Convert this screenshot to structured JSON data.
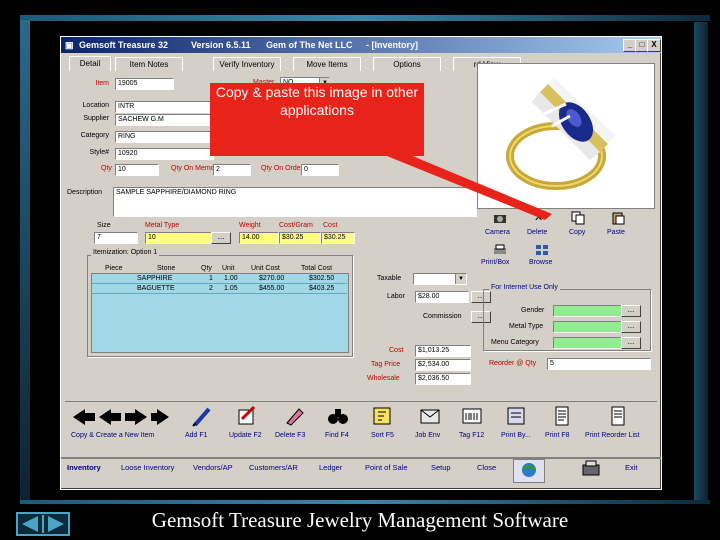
{
  "window": {
    "title_app": "Gemsoft Treasure 32",
    "title_version": "Version 6.5.11",
    "title_company": "Gem of The Net LLC",
    "title_view": "- [Inventory]",
    "btn_min": "_",
    "btn_max": "□",
    "btn_close": "X"
  },
  "tabs": [
    "Detail",
    "Item Notes",
    "Verify Inventory",
    "Move Items",
    "Options",
    "rd View"
  ],
  "form": {
    "item_label": "Item",
    "item_value": "19005",
    "master_label": "Master",
    "master_value": "NO",
    "location_label": "Location",
    "location_value": "INTR",
    "supplier_label": "Supplier",
    "supplier_value": "SACHEW G.M",
    "category_label": "Category",
    "category_value": "RING",
    "style_label": "Style#",
    "style_value": "10920",
    "qty_label": "Qty",
    "qty_value": "10",
    "qty_memo_label": "Qty On Memo",
    "qty_memo_value": "2",
    "qty_order_label": "Qty On Order",
    "qty_order_value": "0",
    "description_label": "Description",
    "description_value": "SAMPLE SAPPHIRE/DIAMOND RING",
    "size_label": "Size",
    "size_value": "7",
    "metal_label": "Metal Type",
    "metal_value": "10",
    "weight_label": "Weight",
    "weight_value": "14.00",
    "costgram_label": "Cost/Gram",
    "costgram_value": "$30.25",
    "cost_label": "Cost",
    "cost_value": "$30.25",
    "ellipsis": "..."
  },
  "itemization": {
    "title": "Itemization: Option 1",
    "headers": [
      "Piece",
      "Stone",
      "Qty",
      "Unit",
      "Unit Cost",
      "Total Cost"
    ],
    "rows": [
      [
        "",
        "SAPPHIRE",
        "1",
        "1.00",
        "$270.00",
        "$302.50"
      ],
      [
        "",
        "BAGUETTE",
        "2",
        "1.05",
        "$455.00",
        "$403.25"
      ]
    ]
  },
  "right_fields": {
    "taxable_label": "Taxable",
    "labor_label": "Labor",
    "labor_value": "$28.00",
    "commission_label": "Commission",
    "cost_label": "Cost",
    "cost_value": "$1,013.25",
    "tag_price_label": "Tag Price",
    "tag_price_value": "$2,534.00",
    "wholesale_label": "Wholesale",
    "wholesale_value": "$2,036.50",
    "reorder_label": "Reorder @ Qty",
    "reorder_value": "5"
  },
  "internet": {
    "title": "For Internet Use Only",
    "gender_label": "Gender",
    "metal_type_label": "Metal Type",
    "menu_cat_label": "Menu Category"
  },
  "image_buttons": {
    "camera": "Camera",
    "delete": "Delete",
    "copy": "Copy",
    "paste": "Paste",
    "print_box": "Print/Box",
    "browse": "Browse"
  },
  "callout": {
    "text": "Copy & paste this image in other applications"
  },
  "toolbar": {
    "copy_new": "Copy & Create a New Item",
    "add": "Add F1",
    "update": "Update F2",
    "delete": "Delete F3",
    "find": "Find F4",
    "sort": "Sort F5",
    "job_env": "Job Env",
    "tag": "Tag F12",
    "print_by": "Print By...",
    "print": "Print F8",
    "print_reorder": "Print Reorder List"
  },
  "bottom_tabs": [
    "Inventory",
    "Loose Inventory",
    "Vendors/AP",
    "Customers/AR",
    "Ledger",
    "Point of Sale",
    "Setup",
    "Close",
    "",
    "",
    "Exit"
  ],
  "caption": "Gemsoft Treasure  Jewelry Management Software",
  "colors": {
    "title_start": "#0a246a",
    "field_yellow": "#ffff80",
    "field_green": "#90ee90",
    "grid_blue": "#a0d8e8",
    "callout_red": "#e8241a"
  }
}
